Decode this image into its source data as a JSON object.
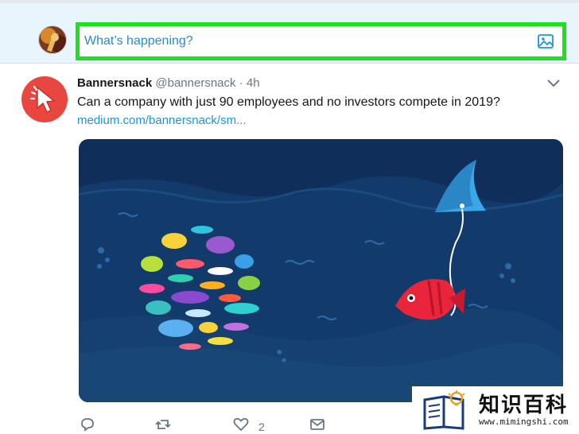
{
  "compose": {
    "placeholder": "What’s happening?",
    "avatar_icon": "user-avatar",
    "media_icon": "image-icon",
    "highlight_color": "#1ee11e"
  },
  "tweet": {
    "author_name": "Bannersnack",
    "author_handle": "@bannersnack",
    "separator": "·",
    "timestamp": "4h",
    "text": "Can a company with just 90 employees and no investors compete in 2019?",
    "link": "medium.com/bannersnack/sm...",
    "avatar_icon": "cursor-logo",
    "menu_icon": "chevron-down-icon",
    "brand_color": "#e8463f",
    "link_color": "#1b95e0"
  },
  "actions": {
    "reply_icon": "reply-icon",
    "retweet_icon": "retweet-icon",
    "like_icon": "heart-icon",
    "like_count": "2",
    "message_icon": "envelope-icon"
  },
  "watermark": {
    "text": "知识百科",
    "url": "www.mimingshi.com",
    "icon": "book-bulb-logo"
  }
}
